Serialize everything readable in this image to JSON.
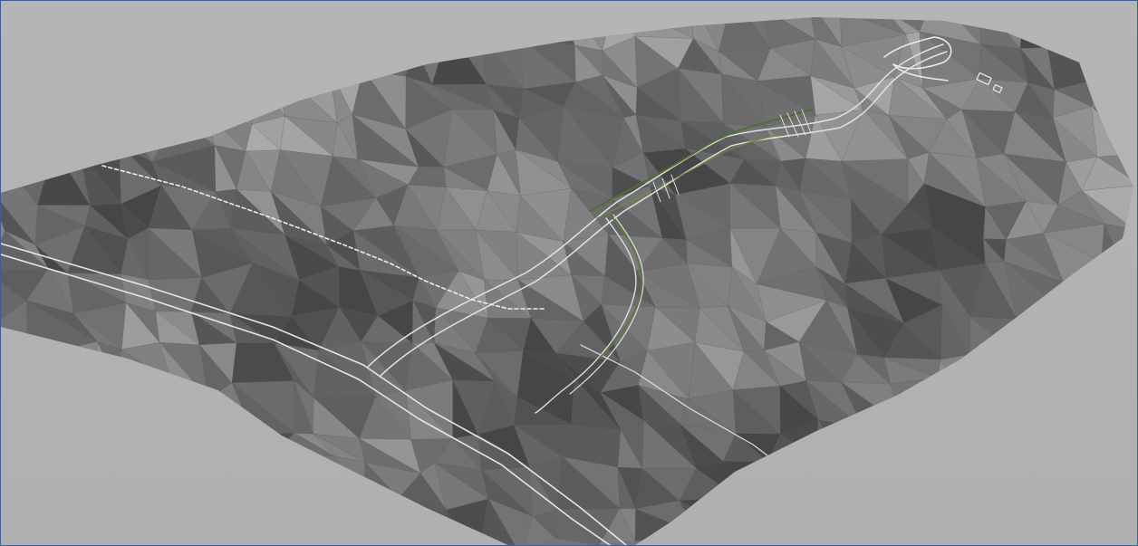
{
  "scene": {
    "background_color": "#b3b3b3",
    "frame_border_color": "#3c5f8f",
    "terrain_base_color": "#7f7f7f",
    "terrain_light_color": "#c4c4c4",
    "terrain_dark_color": "#545454",
    "road_color": "#e4e4e4",
    "vegetation_color": "#5a7a3a",
    "description_icon": "terrain-mesh-icon"
  }
}
